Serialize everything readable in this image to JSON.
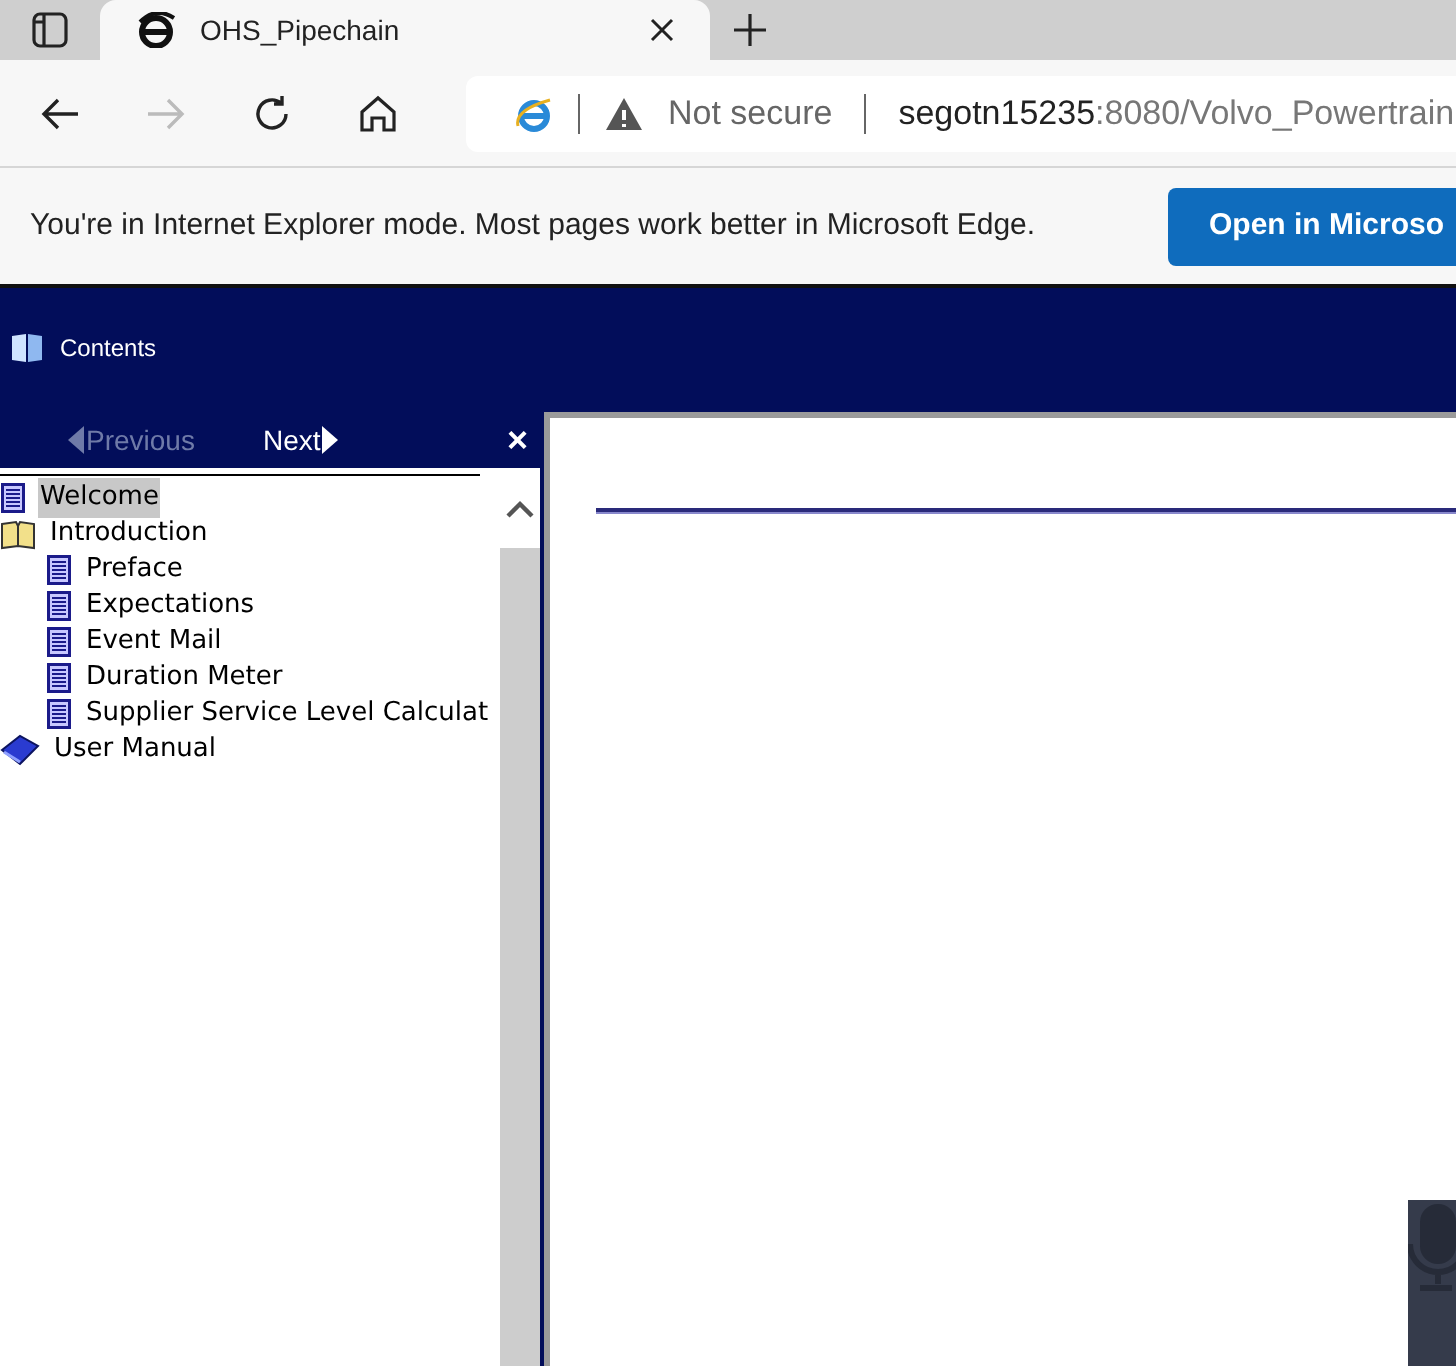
{
  "tab": {
    "title": "OHS_Pipechain"
  },
  "address": {
    "security": "Not secure",
    "host": "segotn15235",
    "path": ":8080/Volvo_Powertrain"
  },
  "infobar": {
    "message": "You're in Internet Explorer mode. Most pages work better in Microsoft Edge.",
    "button": "Open in Microso"
  },
  "header": {
    "label": "Contents"
  },
  "nav": {
    "previous": {
      "label": "Previous",
      "disabled": true
    },
    "next": {
      "label": "Next",
      "disabled": false
    },
    "close": "×"
  },
  "tree": [
    {
      "label": "Welcome",
      "kind": "page",
      "selected": true
    },
    {
      "label": "Introduction",
      "kind": "book",
      "expanded": true,
      "selected": false,
      "children": [
        {
          "label": "Preface",
          "kind": "page",
          "selected": false
        },
        {
          "label": "Expectations",
          "kind": "page",
          "selected": false
        },
        {
          "label": "Event Mail",
          "kind": "page",
          "selected": false
        },
        {
          "label": "Duration Meter",
          "kind": "page",
          "selected": false
        },
        {
          "label": "Supplier Service Level Calculat",
          "kind": "page",
          "selected": false
        }
      ]
    },
    {
      "label": "User Manual",
      "kind": "book",
      "expanded": false,
      "selected": false
    }
  ]
}
